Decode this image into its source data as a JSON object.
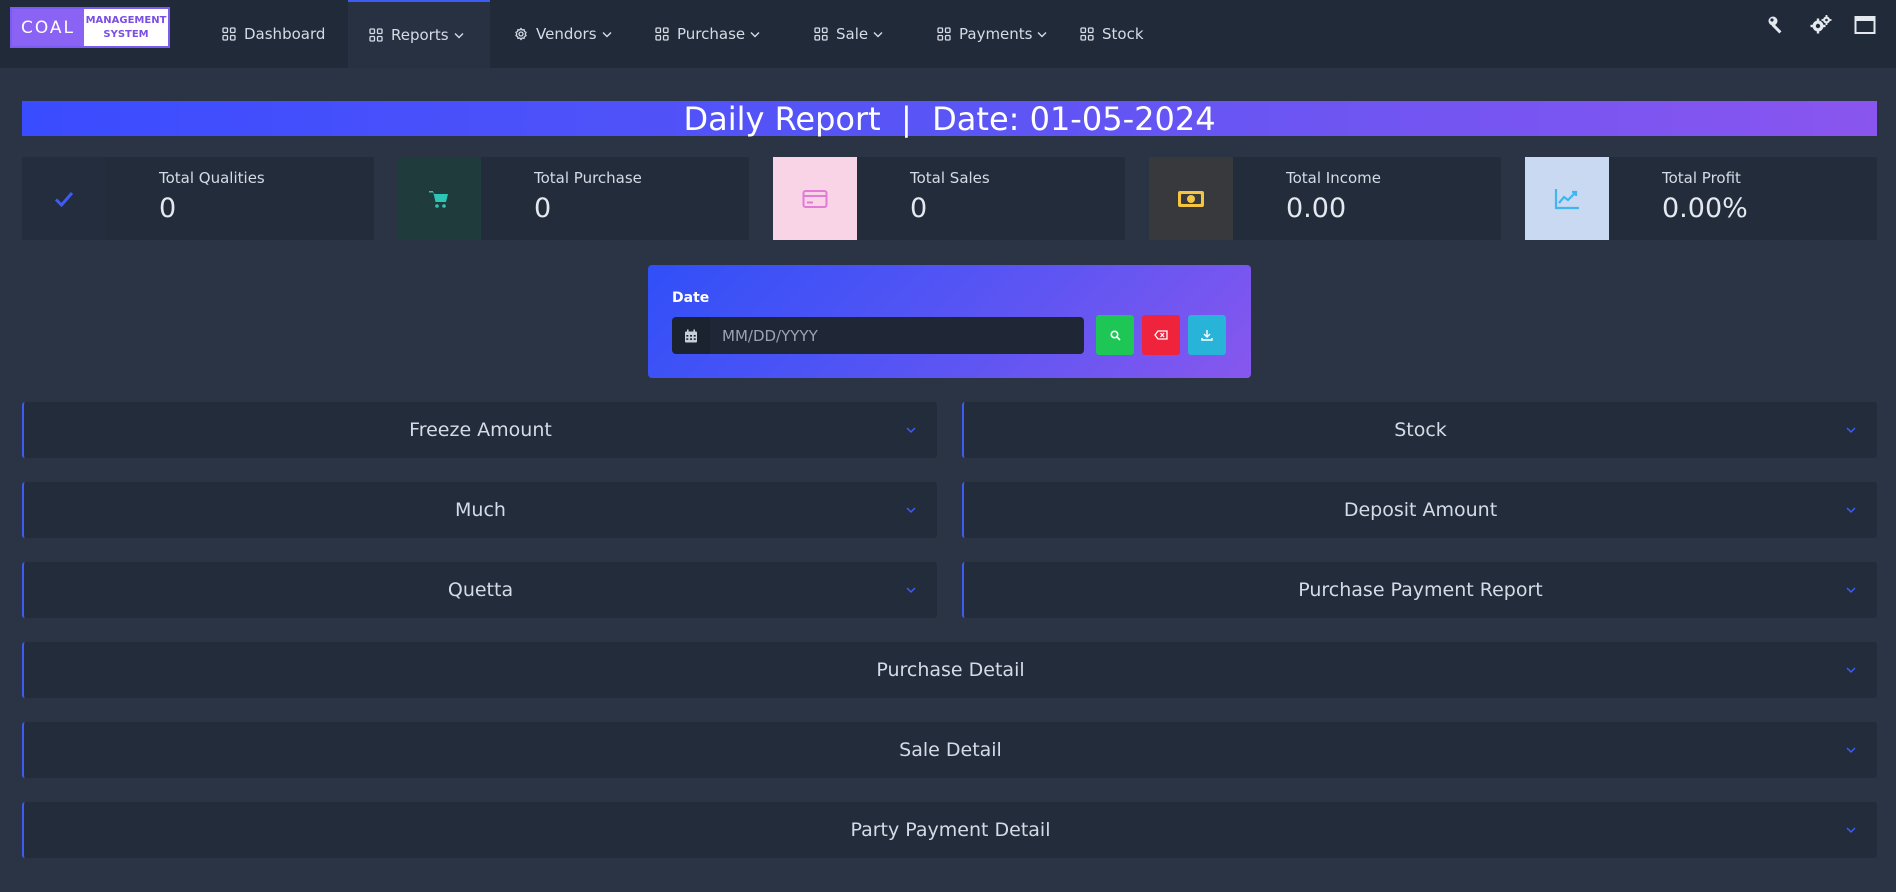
{
  "logo": {
    "left": "COAL",
    "right_line1": "MANAGEMENT",
    "right_line2": "SYSTEM"
  },
  "nav": {
    "items": [
      {
        "label": "Dashboard",
        "icon": "grid-icon",
        "dropdown": false,
        "active": false
      },
      {
        "label": "Reports",
        "icon": "grid-icon",
        "dropdown": true,
        "active": true
      },
      {
        "label": "Vendors",
        "icon": "gear-icon",
        "dropdown": true,
        "active": false
      },
      {
        "label": "Purchase",
        "icon": "grid-icon",
        "dropdown": true,
        "active": false
      },
      {
        "label": "Sale",
        "icon": "grid-icon",
        "dropdown": true,
        "active": false
      },
      {
        "label": "Payments",
        "icon": "grid-icon",
        "dropdown": true,
        "active": false
      },
      {
        "label": "Stock",
        "icon": "grid-icon",
        "dropdown": false,
        "active": false
      }
    ],
    "right_icons": [
      "key-icon",
      "settings-icon",
      "window-icon"
    ]
  },
  "banner": {
    "title": "Daily Report  |  Date: 01-05-2024"
  },
  "stats": [
    {
      "label": "Total Qualities",
      "value": "0",
      "icon": "check-icon",
      "icon_color": "#3b5cf5",
      "bg": "#242d3e"
    },
    {
      "label": "Total Purchase",
      "value": "0",
      "icon": "cart-icon",
      "icon_color": "#2ec4b6",
      "bg": "#1f3b3c"
    },
    {
      "label": "Total Sales",
      "value": "0",
      "icon": "credit-card-icon",
      "icon_color": "#e27bd5",
      "bg": "#f9d3e6"
    },
    {
      "label": "Total Income",
      "value": "0.00",
      "icon": "money-icon",
      "icon_color": "#f5c542",
      "bg": "#37393c"
    },
    {
      "label": "Total Profit",
      "value": "0.00%",
      "icon": "chart-line-icon",
      "icon_color": "#3fb6f0",
      "bg": "#c9d9f2"
    }
  ],
  "filter": {
    "label": "Date",
    "placeholder": "MM/DD/YYYY",
    "buttons": [
      {
        "name": "search-button",
        "icon": "search-icon",
        "color": "#1ec655"
      },
      {
        "name": "clear-button",
        "icon": "backspace-icon",
        "color": "#ef233c"
      },
      {
        "name": "download-button",
        "icon": "download-icon",
        "color": "#27b4d8"
      }
    ]
  },
  "accordions": {
    "freeze_amount": "Freeze Amount",
    "stock": "Stock",
    "much": "Much",
    "deposit_amount": "Deposit Amount",
    "quetta": "Quetta",
    "purchase_payment_report": "Purchase Payment Report",
    "purchase_detail": "Purchase Detail",
    "sale_detail": "Sale Detail",
    "party_payment_detail": "Party Payment Detail"
  },
  "colors": {
    "accent": "#3b5cf5",
    "background": "#2b3444",
    "panel": "#232c3b",
    "navbar": "#212a38"
  }
}
